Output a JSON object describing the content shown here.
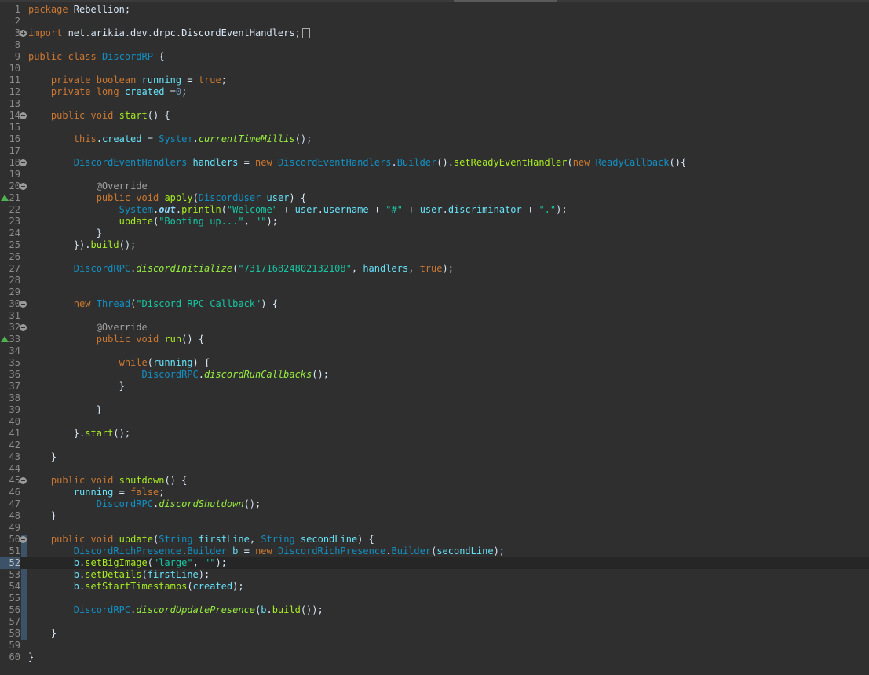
{
  "editor": {
    "lines": [
      {
        "n": "1",
        "text": "package Rebellion;"
      },
      {
        "n": "2",
        "text": ""
      },
      {
        "n": "3",
        "text": "import net.arikia.dev.drpc.DiscordEventHandlers;"
      },
      {
        "n": "8",
        "text": ""
      },
      {
        "n": "9",
        "text": "public class DiscordRP {"
      },
      {
        "n": "10",
        "text": ""
      },
      {
        "n": "11",
        "text": "    private boolean running = true;"
      },
      {
        "n": "12",
        "text": "    private long created =0;"
      },
      {
        "n": "13",
        "text": ""
      },
      {
        "n": "14",
        "text": "    public void start() {"
      },
      {
        "n": "15",
        "text": ""
      },
      {
        "n": "16",
        "text": "        this.created = System.currentTimeMillis();"
      },
      {
        "n": "17",
        "text": ""
      },
      {
        "n": "18",
        "text": "        DiscordEventHandlers handlers = new DiscordEventHandlers.Builder().setReadyEventHandler(new ReadyCallback(){"
      },
      {
        "n": "19",
        "text": ""
      },
      {
        "n": "20",
        "text": "            @Override"
      },
      {
        "n": "21",
        "text": "            public void apply(DiscordUser user) {"
      },
      {
        "n": "22",
        "text": "                System.out.println(\"Welcome\" + user.username + \"#\" + user.discriminator + \".\");"
      },
      {
        "n": "23",
        "text": "                update(\"Booting up...\", \"\");"
      },
      {
        "n": "24",
        "text": "            }"
      },
      {
        "n": "25",
        "text": "        }).build();"
      },
      {
        "n": "26",
        "text": ""
      },
      {
        "n": "27",
        "text": "        DiscordRPC.discordInitialize(\"731716824802132108\", handlers, true);"
      },
      {
        "n": "28",
        "text": ""
      },
      {
        "n": "29",
        "text": ""
      },
      {
        "n": "30",
        "text": "        new Thread(\"Discord RPC Callback\") {"
      },
      {
        "n": "31",
        "text": ""
      },
      {
        "n": "32",
        "text": "            @Override"
      },
      {
        "n": "33",
        "text": "            public void run() {"
      },
      {
        "n": "34",
        "text": ""
      },
      {
        "n": "35",
        "text": "                while(running) {"
      },
      {
        "n": "36",
        "text": "                    DiscordRPC.discordRunCallbacks();"
      },
      {
        "n": "37",
        "text": "                }"
      },
      {
        "n": "38",
        "text": ""
      },
      {
        "n": "39",
        "text": "            }"
      },
      {
        "n": "40",
        "text": ""
      },
      {
        "n": "41",
        "text": "        }.start();"
      },
      {
        "n": "42",
        "text": ""
      },
      {
        "n": "43",
        "text": "    }"
      },
      {
        "n": "44",
        "text": ""
      },
      {
        "n": "45",
        "text": "    public void shutdown() {"
      },
      {
        "n": "46",
        "text": "        running = false;"
      },
      {
        "n": "47",
        "text": "            DiscordRPC.discordShutdown();"
      },
      {
        "n": "48",
        "text": "    }"
      },
      {
        "n": "49",
        "text": ""
      },
      {
        "n": "50",
        "text": "    public void update(String firstLine, String secondLine) {"
      },
      {
        "n": "51",
        "text": "        DiscordRichPresence.Builder b = new DiscordRichPresence.Builder(secondLine);"
      },
      {
        "n": "52",
        "text": "        b.setBigImage(\"large\", \"\");"
      },
      {
        "n": "53",
        "text": "        b.setDetails(firstLine);"
      },
      {
        "n": "54",
        "text": "        b.setStartTimestamps(created);"
      },
      {
        "n": "55",
        "text": ""
      },
      {
        "n": "56",
        "text": "        DiscordRPC.discordUpdatePresence(b.build());"
      },
      {
        "n": "57",
        "text": ""
      },
      {
        "n": "58",
        "text": "    }"
      },
      {
        "n": "59",
        "text": ""
      },
      {
        "n": "60",
        "text": "}"
      }
    ],
    "current_line": "52"
  },
  "colors": {
    "background": "#2f2f2f",
    "keyword": "#cc7832",
    "class": "#1290c3",
    "field": "#66e1f8",
    "method": "#a7ec21",
    "string": "#17c6a3",
    "annotation": "#a0a0a0"
  }
}
